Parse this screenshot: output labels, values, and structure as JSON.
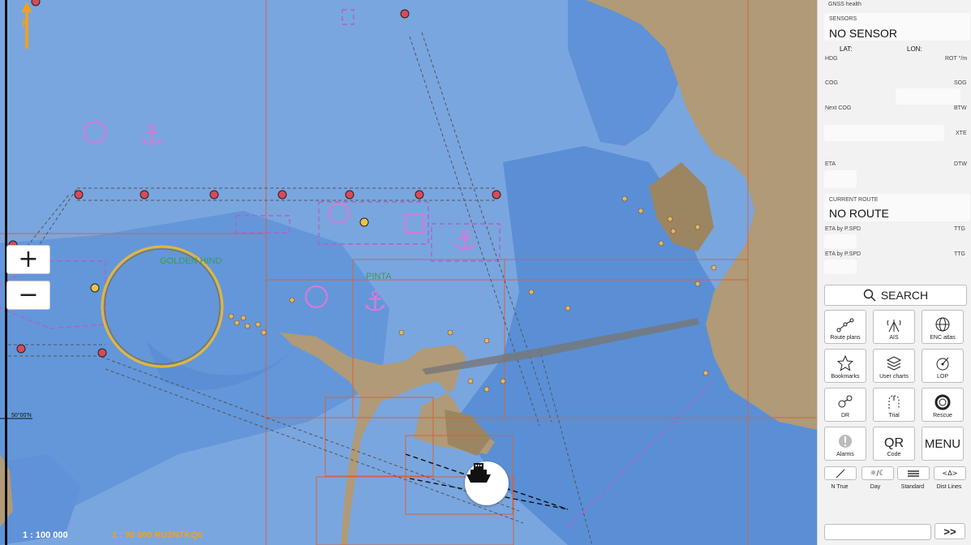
{
  "map": {
    "north_label": "N",
    "zoom_in": "+",
    "zoom_out": "−",
    "scale": "1 : 100 000",
    "chart_scale": "1 : 90 000  RU3NTKQ0",
    "latitude_tick": "50°00'N",
    "place_names": [
      "GOLDEN HIND",
      "PINTA"
    ],
    "colors": {
      "deep_water": "#7aa6df",
      "shallow_water": "#5a8fd6",
      "land": "#b09a77",
      "route_magenta": "#b45fc8",
      "cell_border": "#d2643c"
    },
    "ship_button_icon": "ship-icon"
  },
  "panel": {
    "gnss": "GNSS health",
    "sensors_heading": "SENSORS",
    "sensors_value": "NO SENSOR",
    "lat_label": "LAT:",
    "lon_label": "LON:",
    "hdg": "HDG",
    "rot": "ROT °/m",
    "cog": "COG",
    "sog": "SOG",
    "next_cog": "Next COG",
    "btw": "BTW",
    "xte": "XTE",
    "eta": "ETA",
    "dtw": "DTW",
    "current_route_heading": "CURRENT ROUTE",
    "current_route_value": "NO ROUTE",
    "eta_pspd_1": "ETA by P.SPD",
    "ttg_1": "TTG",
    "eta_pspd_2": "ETA by P.SPD",
    "ttg_2": "TTG",
    "search": "SEARCH",
    "tiles": [
      {
        "label": "Route plans",
        "icon": "route-icon"
      },
      {
        "label": "AIS",
        "icon": "ais-icon"
      },
      {
        "label": "ENC atlas",
        "icon": "globe-icon"
      },
      {
        "label": "Bookmarks",
        "icon": "star-icon"
      },
      {
        "label": "User charts",
        "icon": "layers-icon"
      },
      {
        "label": "LOP",
        "icon": "lop-icon"
      },
      {
        "label": "DR",
        "icon": "dr-icon"
      },
      {
        "label": "Trial",
        "icon": "trial-icon"
      },
      {
        "label": "Rescue",
        "icon": "lifebuoy-icon"
      },
      {
        "label": "Alarms",
        "icon": "alarm-icon"
      },
      {
        "label": "Code",
        "icon": "qr-icon",
        "top": "QR"
      },
      {
        "label": "",
        "icon": "",
        "top": "MENU"
      }
    ],
    "small_buttons": [
      {
        "label": "N True",
        "icon": "compass-icon"
      },
      {
        "label": "Day",
        "icon": "day-night-icon"
      },
      {
        "label": "Standard",
        "icon": "standard-icon"
      },
      {
        "label": "Dist Lines",
        "icon": "dist-lines-icon",
        "glyph": "<Δ>"
      }
    ],
    "collapse_button": ">>"
  }
}
